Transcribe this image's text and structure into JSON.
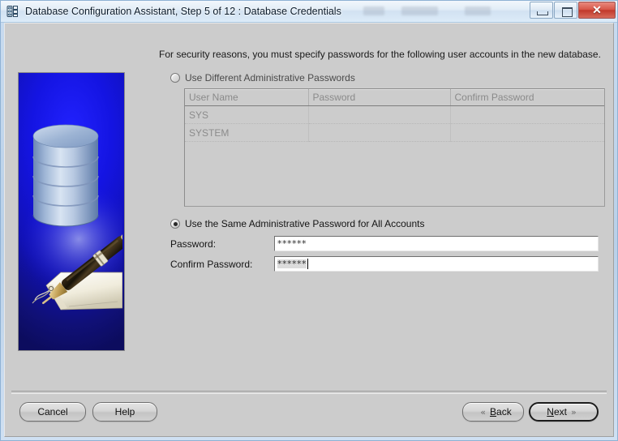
{
  "window": {
    "title": "Database Configuration Assistant, Step 5 of 12 : Database Credentials",
    "icon": "database-grid-icon",
    "minimize_label": "Minimize",
    "maximize_label": "Maximize",
    "close_label": "✕"
  },
  "illustration": {
    "alt": "database-cylinder-with-pen-and-tag-illustration",
    "bg_color_top": "#2222ff",
    "bg_color_bottom": "#0c0c5e"
  },
  "main": {
    "intro": "For security reasons, you must specify passwords for the following user accounts in the new database.",
    "option_different": {
      "label": "Use Different Administrative Passwords",
      "selected": false
    },
    "option_same": {
      "label": "Use the Same Administrative Password for All Accounts",
      "selected": true
    },
    "table": {
      "columns": [
        "User Name",
        "Password",
        "Confirm Password"
      ],
      "rows": [
        {
          "user_name": "SYS",
          "password": "",
          "confirm_password": ""
        },
        {
          "user_name": "SYSTEM",
          "password": "",
          "confirm_password": ""
        }
      ],
      "enabled": false
    },
    "password_field": {
      "label": "Password:",
      "value": "******",
      "masked_length": 6
    },
    "confirm_password_field": {
      "label": "Confirm Password:",
      "value": "******",
      "masked_length": 6,
      "focused": true
    }
  },
  "footer": {
    "cancel": {
      "label": "Cancel"
    },
    "help": {
      "label": "Help"
    },
    "back": {
      "label": "Back",
      "mnemonic": "B",
      "icon": "chevron-left-double-icon"
    },
    "next": {
      "label": "Next",
      "mnemonic": "N",
      "icon": "chevron-right-double-icon",
      "default": true
    }
  }
}
